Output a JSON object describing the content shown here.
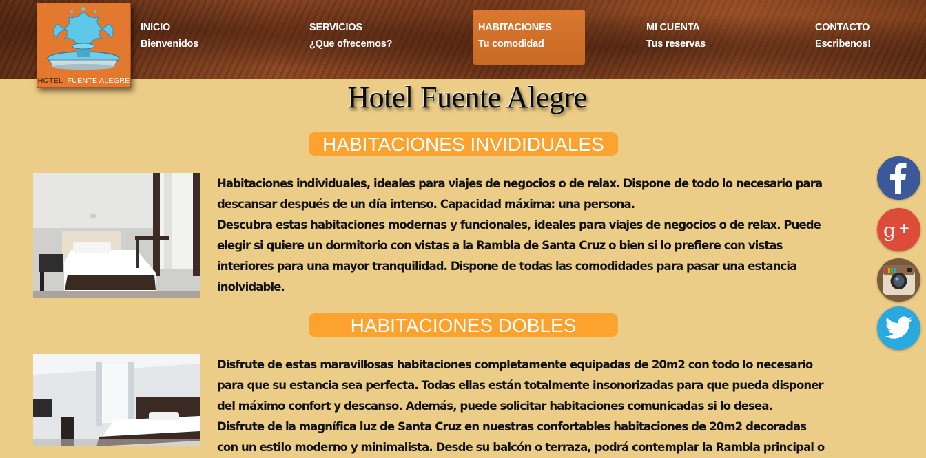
{
  "logo": {
    "text_left": "HOTEL",
    "text_right": "FUENTE ALEGRE"
  },
  "nav": [
    {
      "title": "INICIO",
      "subtitle": "Bienvenidos",
      "active": false
    },
    {
      "title": "SERVICIOS",
      "subtitle": "¿Que ofrecemos?",
      "active": false
    },
    {
      "title": "HABITACIONES",
      "subtitle": "Tu comodidad",
      "active": true
    },
    {
      "title": "MI CUENTA",
      "subtitle": "Tus reservas",
      "active": false
    },
    {
      "title": "CONTACTO",
      "subtitle": "Escribenos!",
      "active": false
    }
  ],
  "site_title": "Hotel Fuente Alegre",
  "sections": [
    {
      "heading": "HABITACIONES INVIDIDUALES",
      "paragraphs": [
        "Habitaciones individuales, ideales para viajes de negocios o de relax. Dispone de todo lo necesario para descansar después de un día intenso. Capacidad máxima: una persona.",
        "Descubra estas habitaciones modernas y funcionales, ideales para viajes de negocios o de relax. Puede elegir si quiere un dormitorio con vistas a la Rambla de Santa Cruz o bien si lo prefiere con vistas interiores para una mayor tranquilidad. Dispone de todas las comodidades para pasar una estancia inolvidable."
      ]
    },
    {
      "heading": "HABITACIONES DOBLES",
      "paragraphs": [
        "Disfrute de estas maravillosas habitaciones completamente equipadas de 20m2 con todo lo necesario para que su estancia sea perfecta. Todas ellas están totalmente insonorizadas para que pueda disponer del máximo confort y descanso. Además, puede solicitar habitaciones comunicadas si lo desea.",
        "Disfrute de la magnífica luz de Santa Cruz en nuestras confortables habitaciones de 20m2 decoradas con un estilo moderno y minimalista. Desde su balcón o terraza, podrá contemplar la Rambla principal o"
      ]
    }
  ],
  "social": [
    {
      "icon": "facebook-icon",
      "glyph": "f",
      "color": "#3b5998"
    },
    {
      "icon": "google-plus-icon",
      "glyph": "g+",
      "color": "#dd4b39"
    },
    {
      "icon": "instagram-icon",
      "glyph": "",
      "color": "#8a6a4a"
    },
    {
      "icon": "twitter-icon",
      "glyph": "",
      "color": "#2aa9e0"
    }
  ],
  "colors": {
    "background": "#eccd87",
    "section_heading": "#fba22f",
    "nav_active": "#d9782e"
  }
}
